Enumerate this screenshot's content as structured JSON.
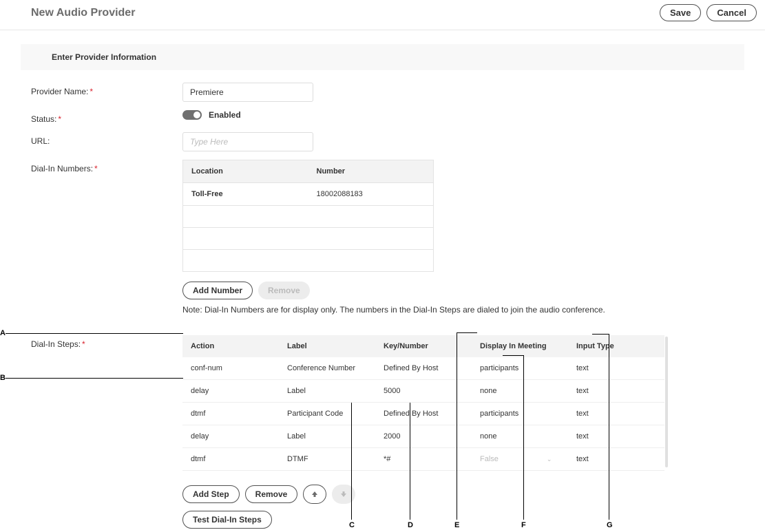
{
  "header": {
    "title": "New Audio Provider",
    "save": "Save",
    "cancel": "Cancel"
  },
  "section_title": "Enter Provider Information",
  "form": {
    "provider_name": {
      "label": "Provider Name:",
      "value": "Premiere"
    },
    "status": {
      "label": "Status:",
      "value": "Enabled"
    },
    "url": {
      "label": "URL:",
      "placeholder": "Type Here"
    },
    "dial_in_numbers": {
      "label": "Dial-In Numbers:",
      "columns": {
        "location": "Location",
        "number": "Number"
      },
      "rows": [
        {
          "location": "Toll-Free",
          "number": "18002088183"
        },
        {
          "location": "",
          "number": ""
        },
        {
          "location": "",
          "number": ""
        },
        {
          "location": "",
          "number": ""
        }
      ],
      "add_number": "Add Number",
      "remove": "Remove",
      "note": "Note: Dial-In Numbers are for display only. The numbers in the Dial-In Steps are dialed to join the audio conference."
    },
    "dial_in_steps": {
      "label": "Dial-In Steps:",
      "columns": {
        "action": "Action",
        "label": "Label",
        "key_number": "Key/Number",
        "display": "Display In Meeting",
        "input_type": "Input Type"
      },
      "rows": [
        {
          "action": "conf-num",
          "label": "Conference Number",
          "key_number": "Defined By Host",
          "display": "participants",
          "input_type": "text"
        },
        {
          "action": "delay",
          "label": "Label",
          "key_number": "5000",
          "display": "none",
          "input_type": "text"
        },
        {
          "action": "dtmf",
          "label": "Participant Code",
          "key_number": "Defined By Host",
          "display": "participants",
          "input_type": "text"
        },
        {
          "action": "delay",
          "label": "Label",
          "key_number": "2000",
          "display": "none",
          "input_type": "text"
        },
        {
          "action": "dtmf",
          "label": "DTMF",
          "key_number": "*#",
          "display": "False",
          "input_type": "text"
        }
      ],
      "add_step": "Add Step",
      "remove": "Remove",
      "test": "Test Dial-In Steps"
    }
  },
  "annotations": {
    "A": "A",
    "B": "B",
    "C": "C",
    "D": "D",
    "E": "E",
    "F": "F",
    "G": "G"
  }
}
